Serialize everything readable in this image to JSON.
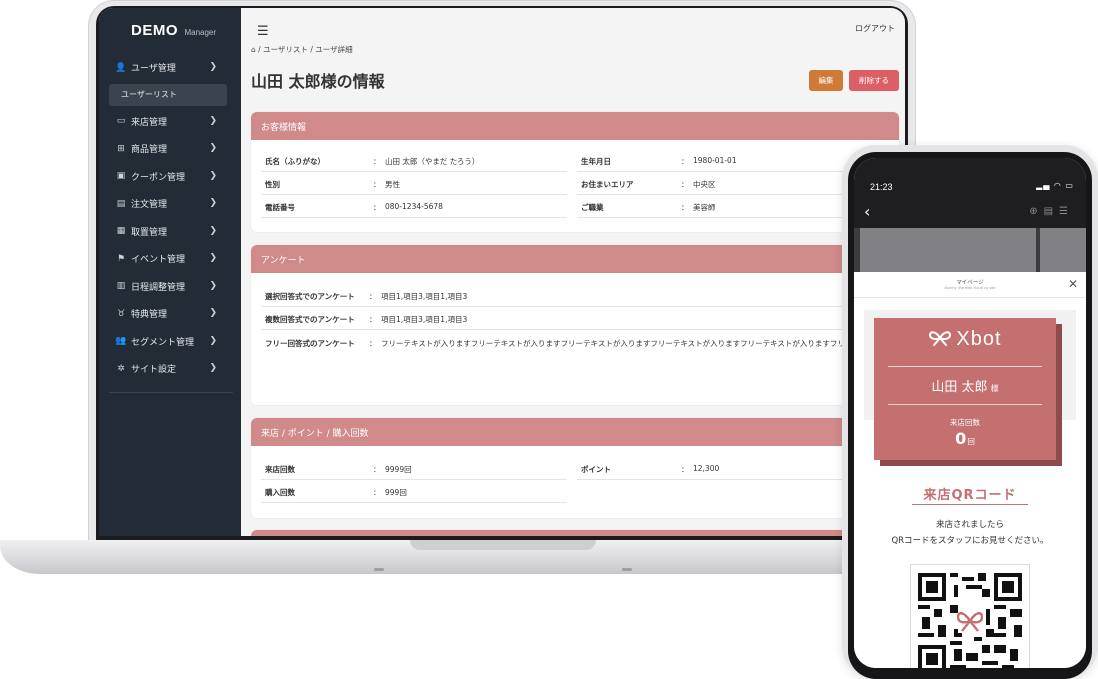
{
  "admin": {
    "brand": "DEMO",
    "brand_sub": "Manager",
    "sidebar": {
      "items": [
        {
          "label": "ユーザ管理",
          "icon": "user-icon",
          "glyph": "👤"
        },
        {
          "label": "来店管理",
          "icon": "store-icon",
          "glyph": "▭"
        },
        {
          "label": "商品管理",
          "icon": "gift-icon",
          "glyph": "⊞"
        },
        {
          "label": "クーポン管理",
          "icon": "ticket-icon",
          "glyph": "▣"
        },
        {
          "label": "注文管理",
          "icon": "clipboard-icon",
          "glyph": "▤"
        },
        {
          "label": "取置管理",
          "icon": "boxes-icon",
          "glyph": "▦"
        },
        {
          "label": "イベント管理",
          "icon": "flag-icon",
          "glyph": "⚑"
        },
        {
          "label": "日程調整管理",
          "icon": "calendar-icon",
          "glyph": "▥"
        },
        {
          "label": "特典管理",
          "icon": "award-icon",
          "glyph": "♉"
        },
        {
          "label": "セグメント管理",
          "icon": "users-icon",
          "glyph": "👥"
        },
        {
          "label": "サイト設定",
          "icon": "gear-icon",
          "glyph": "✲"
        }
      ],
      "sub_item": "ユーザーリスト"
    },
    "header": {
      "logout": "ログアウト",
      "breadcrumb_sep": "/",
      "breadcrumb": [
        "ユーザリスト",
        "ユーザ詳細"
      ],
      "title": "山田 太郎様の情報",
      "edit_label": "編集",
      "delete_label": "削除する"
    },
    "customer": {
      "title": "お客様情報",
      "rows": [
        {
          "label": "氏名（ふりがな）",
          "value": "山田 太郎（やまだ たろう）"
        },
        {
          "label": "生年月日",
          "value": "1980-01-01"
        },
        {
          "label": "性別",
          "value": "男性"
        },
        {
          "label": "お住まいエリア",
          "value": "中央区"
        },
        {
          "label": "電話番号",
          "value": "080-1234-5678"
        },
        {
          "label": "ご職業",
          "value": "美容師"
        }
      ]
    },
    "survey": {
      "title": "アンケート",
      "single_label": "選択回答式でのアンケート",
      "single_value": "項目1,項目3,項目1,項目3",
      "multi_label": "複数回答式でのアンケート",
      "multi_value": "項目1,項目3,項目1,項目3",
      "free_label": "フリー回答式のアンケート",
      "free_value": "フリーテキストが入りますフリーテキストが入りますフリーテキストが入りますフリーテキストが入りますフリーテキストが入りますフリーテキストが入りますフリーテキストが入りますフリーテキストが入りますフリーテキストが入りますフリーテキストが入りますフリーテキストが入りますフリーテキストが入ります フリーテキストが入りますフリーテキストが入りますフリーテキストが入ります"
    },
    "stats": {
      "title": "来店 / ポイント / 購入回数",
      "visits_label": "来店回数",
      "visits_value": "9999回",
      "points_label": "ポイント",
      "points_value": "12,300",
      "purchases_label": "購入回数",
      "purchases_value": "999回"
    },
    "separator": "："
  },
  "phone": {
    "time": "21:23",
    "modal_title": "マイページ",
    "modal_subtitle": "Ibunny line web cloud co site",
    "card": {
      "logo": "Xbot",
      "name": "山田 太郎",
      "honorific": "様",
      "visit_label": "来店回数",
      "visit_count": "0",
      "visit_unit": "回"
    },
    "qr": {
      "title": "来店QRコード",
      "line1": "来店されましたら",
      "line2": "QRコードをスタッフにお見せください。"
    },
    "colors": {
      "accent": "#c46f70",
      "header": "#cf8a89"
    }
  }
}
